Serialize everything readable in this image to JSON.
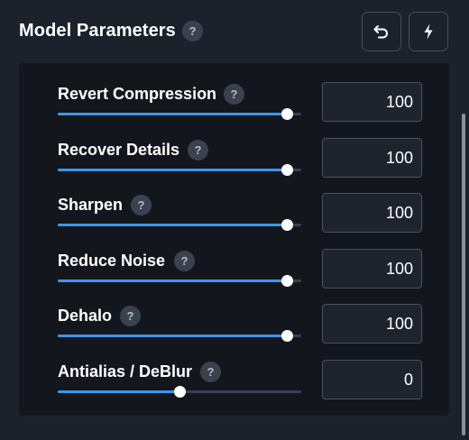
{
  "header": {
    "title": "Model Parameters",
    "help_glyph": "?",
    "undo_icon": "undo-icon",
    "bolt_icon": "lightning-icon"
  },
  "parameters": [
    {
      "label": "Revert Compression",
      "help": "?",
      "value": "100",
      "slider_fraction": 0.94
    },
    {
      "label": "Recover Details",
      "help": "?",
      "value": "100",
      "slider_fraction": 0.94
    },
    {
      "label": "Sharpen",
      "help": "?",
      "value": "100",
      "slider_fraction": 0.94
    },
    {
      "label": "Reduce Noise",
      "help": "?",
      "value": "100",
      "slider_fraction": 0.94
    },
    {
      "label": "Dehalo",
      "help": "?",
      "value": "100",
      "slider_fraction": 0.94
    },
    {
      "label": "Antialias / DeBlur",
      "help": "?",
      "value": "0",
      "slider_fraction": 0.5
    }
  ],
  "colors": {
    "accent": "#3d97e8",
    "background": "#1c222c",
    "panel": "#13171d"
  }
}
